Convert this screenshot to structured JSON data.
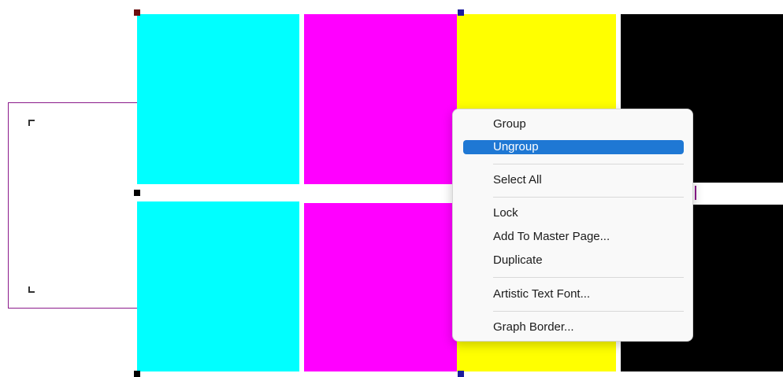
{
  "colors": {
    "cyan": "#00ffff",
    "magenta": "#ff00ff",
    "yellow": "#ffff00",
    "black": "#000000",
    "frame_border": "#8b1a8b",
    "menu_highlight": "#1f78d4"
  },
  "context_menu": {
    "items": [
      {
        "label": "Group",
        "highlighted": false
      },
      {
        "label": "Ungroup",
        "highlighted": true
      },
      {
        "label": "Select All",
        "highlighted": false
      },
      {
        "label": "Lock",
        "highlighted": false
      },
      {
        "label": "Add To Master Page...",
        "highlighted": false
      },
      {
        "label": "Duplicate",
        "highlighted": false
      },
      {
        "label": "Artistic Text Font...",
        "highlighted": false
      },
      {
        "label": "Graph Border...",
        "highlighted": false
      }
    ]
  }
}
